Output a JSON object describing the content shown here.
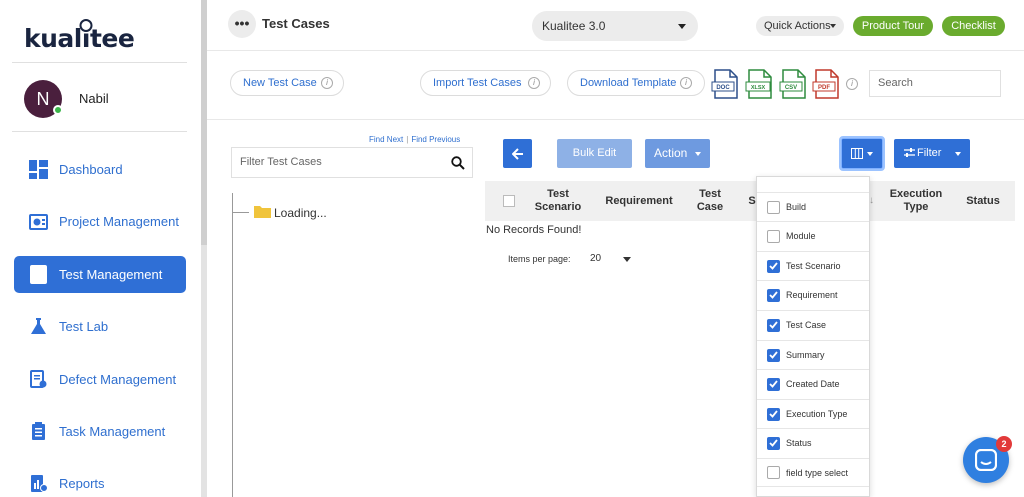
{
  "app": {
    "logo_text_left": "kual",
    "logo_text_i": "i",
    "logo_text_right": "tee"
  },
  "user": {
    "initial": "N",
    "name": "Nabil"
  },
  "sidebar": {
    "items": [
      {
        "label": "Dashboard",
        "icon": "dashboard-icon",
        "active": false
      },
      {
        "label": "Project Management",
        "icon": "project-management-icon",
        "active": false
      },
      {
        "label": "Test Management",
        "icon": "test-management-icon",
        "active": true
      },
      {
        "label": "Test Lab",
        "icon": "flask-icon",
        "active": false
      },
      {
        "label": "Defect Management",
        "icon": "defect-icon",
        "active": false
      },
      {
        "label": "Task Management",
        "icon": "task-icon",
        "active": false
      },
      {
        "label": "Reports",
        "icon": "reports-icon",
        "active": false
      }
    ]
  },
  "header": {
    "more": "•••",
    "title": "Test Cases",
    "project": "Kualitee 3.0",
    "quick_actions": "Quick Actions",
    "product_tour": "Product Tour",
    "checklist": "Checklist"
  },
  "toolbar": {
    "new_test_case": "New Test Case",
    "import_test_cases": "Import Test Cases",
    "download_template": "Download Template",
    "info": "i",
    "file_types": [
      "DOC",
      "XLSX",
      "CSV",
      "PDF"
    ],
    "search_placeholder": "Search"
  },
  "tree": {
    "find_next": "Find Next",
    "separator": "|",
    "find_previous": "Find Previous",
    "filter_placeholder": "Filter Test Cases",
    "loading": "Loading..."
  },
  "grid": {
    "bulk_edit": "Bulk Edit",
    "action": "Action",
    "filter": "Filter",
    "columns": {
      "test_scenario": "Test Scenario",
      "requirement": "Requirement",
      "test_case": "Test Case",
      "s": "S",
      "execution_type": "Execution Type",
      "status": "Status"
    },
    "no_records": "No Records Found!",
    "items_per_page_label": "Items per page:",
    "items_per_page_value": "20"
  },
  "column_menu": {
    "items": [
      {
        "label": "Build",
        "checked": false
      },
      {
        "label": "Module",
        "checked": false
      },
      {
        "label": "Test Scenario",
        "checked": true
      },
      {
        "label": "Requirement",
        "checked": true
      },
      {
        "label": "Test Case",
        "checked": true
      },
      {
        "label": "Summary",
        "checked": true
      },
      {
        "label": "Created Date",
        "checked": true
      },
      {
        "label": "Execution Type",
        "checked": true
      },
      {
        "label": "Status",
        "checked": true
      },
      {
        "label": "field type select",
        "checked": false
      }
    ]
  },
  "chat": {
    "badge": "2"
  },
  "colors": {
    "primary": "#2f6fd6",
    "green": "#6aab2e",
    "link": "#2f6fcf"
  }
}
